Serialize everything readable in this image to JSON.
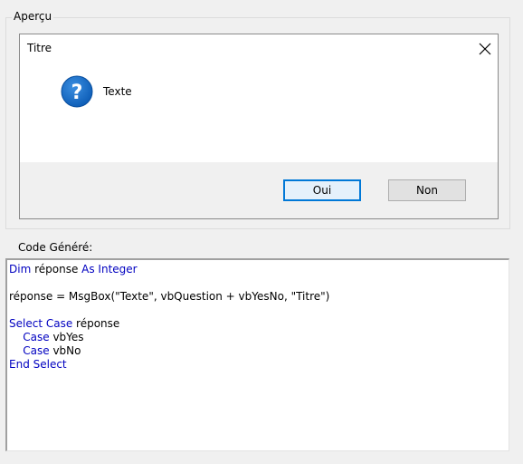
{
  "preview": {
    "group_label": "Aperçu",
    "dialog": {
      "title": "Titre",
      "message": "Texte",
      "icon": "question-icon",
      "buttons": {
        "yes": "Oui",
        "no": "Non"
      }
    }
  },
  "code": {
    "label": "Code Généré:",
    "lines": [
      [
        {
          "t": "Dim",
          "kw": true
        },
        {
          "t": " réponse ",
          "kw": false
        },
        {
          "t": "As Integer",
          "kw": true
        }
      ],
      [],
      [
        {
          "t": "réponse = MsgBox(\"Texte\", vbQuestion + vbYesNo, \"Titre\")",
          "kw": false
        }
      ],
      [],
      [
        {
          "t": "Select Case",
          "kw": true
        },
        {
          "t": " réponse",
          "kw": false
        }
      ],
      [
        {
          "t": "    ",
          "kw": false
        },
        {
          "t": "Case",
          "kw": true
        },
        {
          "t": " vbYes",
          "kw": false
        }
      ],
      [
        {
          "t": "    ",
          "kw": false
        },
        {
          "t": "Case",
          "kw": true
        },
        {
          "t": " vbNo",
          "kw": false
        }
      ],
      [
        {
          "t": "End Select",
          "kw": true
        }
      ]
    ]
  },
  "colors": {
    "keyword": "#0000c0",
    "accent": "#0078d7",
    "icon_blue": "#1a6cc8"
  }
}
